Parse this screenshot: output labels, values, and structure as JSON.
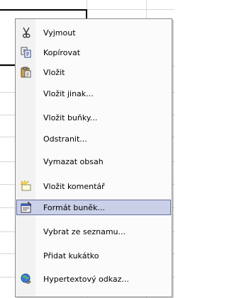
{
  "menu": {
    "items": [
      {
        "label": "Vyjmout",
        "icon": "scissors-icon",
        "highlighted": false
      },
      {
        "label": "Kopírovat",
        "icon": "copy-icon",
        "highlighted": false
      },
      {
        "label": "Vložit",
        "icon": "paste-icon",
        "highlighted": false
      },
      {
        "label": "Vložit jinak...",
        "icon": "",
        "highlighted": false
      },
      {
        "label": "Vložit buňky...",
        "icon": "",
        "highlighted": false
      },
      {
        "label": "Odstranit...",
        "icon": "",
        "highlighted": false
      },
      {
        "label": "Vymazat obsah",
        "icon": "",
        "highlighted": false
      },
      {
        "label": "Vložit komentář",
        "icon": "new-comment-icon",
        "highlighted": false
      },
      {
        "label": "Formát buněk...",
        "icon": "format-cells-icon",
        "highlighted": true
      },
      {
        "label": "Vybrat ze seznamu...",
        "icon": "",
        "highlighted": false
      },
      {
        "label": "Přidat kukátko",
        "icon": "",
        "highlighted": false
      },
      {
        "label": "Hypertextový odkaz...",
        "icon": "hyperlink-icon",
        "highlighted": false
      }
    ],
    "highlight_color": "#c9d0e8"
  }
}
